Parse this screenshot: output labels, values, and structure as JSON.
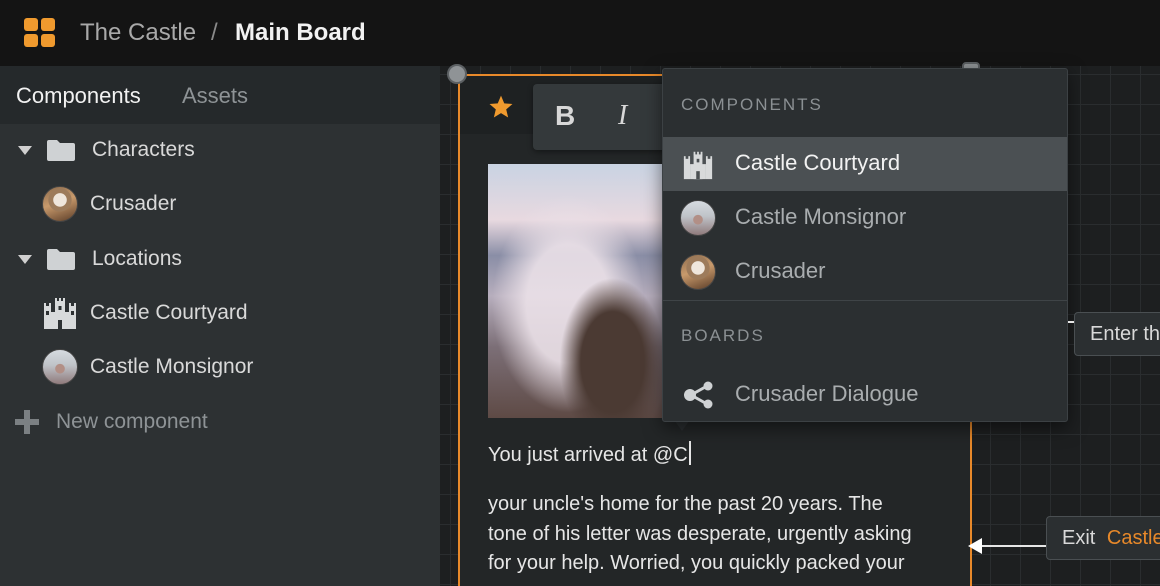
{
  "header": {
    "project": "The Castle",
    "separator": "/",
    "board": "Main Board"
  },
  "sidebar": {
    "tabs": [
      {
        "label": "Components",
        "active": true
      },
      {
        "label": "Assets",
        "active": false
      }
    ],
    "items": [
      {
        "label": "Characters",
        "type": "folder",
        "icon": "folder-icon"
      },
      {
        "label": "Crusader",
        "type": "character",
        "icon": "avatar"
      },
      {
        "label": "Locations",
        "type": "folder",
        "icon": "folder-icon"
      },
      {
        "label": "Castle Courtyard",
        "type": "location",
        "icon": "castle-icon"
      },
      {
        "label": "Castle Monsignor",
        "type": "character",
        "icon": "avatar"
      }
    ],
    "new_component": "New component"
  },
  "toolbar": {
    "bold": "B",
    "italic": "I"
  },
  "editor": {
    "typed_line": "You just arrived at @C",
    "paragraph_lines": [
      "your uncle's home for the past 20 years. The",
      "tone of his letter was desperate, urgently asking",
      "for your help. Worried, you quickly packed your"
    ]
  },
  "dropdown": {
    "components_header": "COMPONENTS",
    "boards_header": "BOARDS",
    "components": [
      {
        "label": "Castle Courtyard",
        "icon": "castle-icon",
        "highlighted": true
      },
      {
        "label": "Castle Monsignor",
        "icon": "avatar",
        "highlighted": false
      },
      {
        "label": "Crusader",
        "icon": "avatar",
        "highlighted": false
      }
    ],
    "boards": [
      {
        "label": "Crusader Dialogue",
        "icon": "board-link-icon"
      }
    ]
  },
  "side_nodes": {
    "enter": "Enter th",
    "exit_prefix": "Exit",
    "exit_link": "Castle"
  },
  "colors": {
    "accent": "#e8892a",
    "logo": "#f09a2e",
    "highlight_row": "#4b5053"
  }
}
